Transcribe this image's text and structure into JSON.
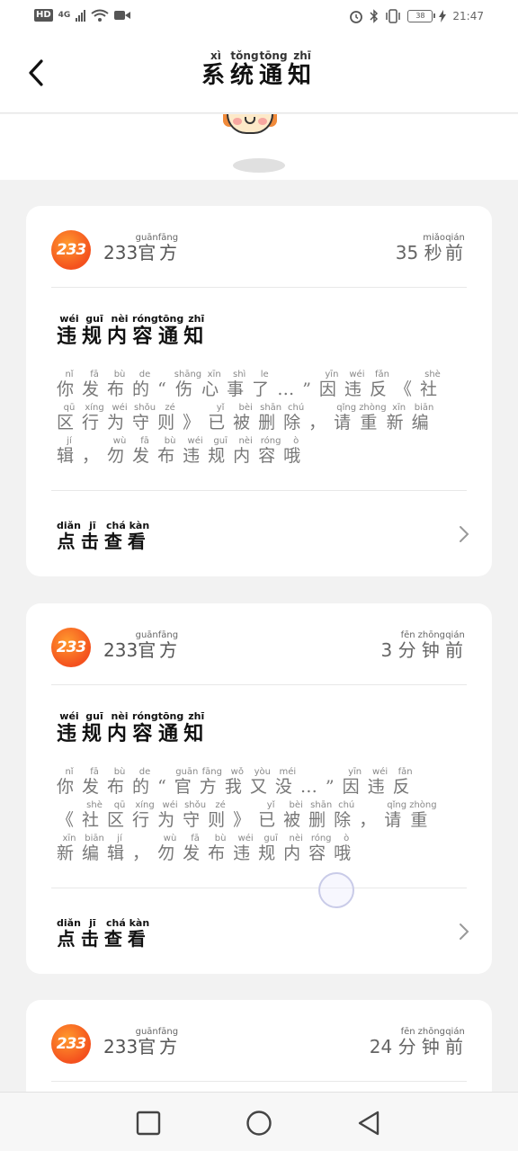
{
  "status_bar": {
    "network_badge": "HD",
    "signal_label": "4G",
    "battery": "38",
    "time": "21:47",
    "icons": [
      "hd-icon",
      "signal-icon",
      "wifi-icon",
      "video-icon",
      "alarm-icon",
      "bluetooth-icon",
      "vibrate-icon",
      "battery-icon",
      "charging-icon"
    ]
  },
  "header": {
    "title": [
      {
        "ch": "系",
        "py": "xì"
      },
      {
        "ch": "统",
        "py": "tǒng"
      },
      {
        "ch": "通",
        "py": "tōng"
      },
      {
        "ch": "知",
        "py": "zhī"
      }
    ]
  },
  "notifications": [
    {
      "logo": "233",
      "sender_num": "233",
      "sender": [
        {
          "ch": "官",
          "py": "guān"
        },
        {
          "ch": "方",
          "py": "fāng"
        }
      ],
      "time_num": "35",
      "time": [
        {
          "ch": "秒",
          "py": "miǎo"
        },
        {
          "ch": "前",
          "py": "qián"
        }
      ],
      "title": [
        {
          "ch": "违",
          "py": "wéi"
        },
        {
          "ch": "规",
          "py": "guī"
        },
        {
          "ch": "内",
          "py": "nèi"
        },
        {
          "ch": "容",
          "py": "róng"
        },
        {
          "ch": "通",
          "py": "tōng"
        },
        {
          "ch": "知",
          "py": "zhī"
        }
      ],
      "body": [
        {
          "ch": "你",
          "py": "nǐ"
        },
        {
          "ch": "发",
          "py": "fā"
        },
        {
          "ch": "布",
          "py": "bù"
        },
        {
          "ch": "的",
          "py": "de"
        },
        {
          "ch": "“",
          "py": ""
        },
        {
          "ch": "伤",
          "py": "shāng"
        },
        {
          "ch": "心",
          "py": "xīn"
        },
        {
          "ch": "事",
          "py": "shì"
        },
        {
          "ch": "了",
          "py": "le"
        },
        {
          "ch": "…",
          "py": ""
        },
        {
          "ch": "”",
          "py": ""
        },
        {
          "ch": "因",
          "py": "yīn"
        },
        {
          "ch": "违",
          "py": "wéi"
        },
        {
          "ch": "反",
          "py": "fǎn"
        },
        {
          "ch": "《",
          "py": ""
        },
        {
          "ch": "社",
          "py": "shè"
        },
        {
          "ch": "区",
          "py": "qū"
        },
        {
          "ch": "行",
          "py": "xíng"
        },
        {
          "ch": "为",
          "py": "wéi"
        },
        {
          "ch": "守",
          "py": "shǒu"
        },
        {
          "ch": "则",
          "py": "zé"
        },
        {
          "ch": "》",
          "py": ""
        },
        {
          "ch": "已",
          "py": "yǐ"
        },
        {
          "ch": "被",
          "py": "bèi"
        },
        {
          "ch": "删",
          "py": "shān"
        },
        {
          "ch": "除",
          "py": "chú"
        },
        {
          "ch": "，",
          "py": ""
        },
        {
          "ch": "请",
          "py": "qǐng"
        },
        {
          "ch": "重",
          "py": "zhòng"
        },
        {
          "ch": "新",
          "py": "xīn"
        },
        {
          "ch": "编",
          "py": "biān"
        },
        {
          "ch": "辑",
          "py": "jí"
        },
        {
          "ch": "，",
          "py": ""
        },
        {
          "ch": "勿",
          "py": "wù"
        },
        {
          "ch": "发",
          "py": "fā"
        },
        {
          "ch": "布",
          "py": "bù"
        },
        {
          "ch": "违",
          "py": "wéi"
        },
        {
          "ch": "规",
          "py": "guī"
        },
        {
          "ch": "内",
          "py": "nèi"
        },
        {
          "ch": "容",
          "py": "róng"
        },
        {
          "ch": "哦",
          "py": "ò"
        }
      ],
      "action": [
        {
          "ch": "点",
          "py": "diǎn"
        },
        {
          "ch": "击",
          "py": "jī"
        },
        {
          "ch": "查",
          "py": "chá"
        },
        {
          "ch": "看",
          "py": "kàn"
        }
      ]
    },
    {
      "logo": "233",
      "sender_num": "233",
      "sender": [
        {
          "ch": "官",
          "py": "guān"
        },
        {
          "ch": "方",
          "py": "fāng"
        }
      ],
      "time_num": "3",
      "time": [
        {
          "ch": "分",
          "py": "fēn"
        },
        {
          "ch": "钟",
          "py": "zhōng"
        },
        {
          "ch": "前",
          "py": "qián"
        }
      ],
      "title": [
        {
          "ch": "违",
          "py": "wéi"
        },
        {
          "ch": "规",
          "py": "guī"
        },
        {
          "ch": "内",
          "py": "nèi"
        },
        {
          "ch": "容",
          "py": "róng"
        },
        {
          "ch": "通",
          "py": "tōng"
        },
        {
          "ch": "知",
          "py": "zhī"
        }
      ],
      "body": [
        {
          "ch": "你",
          "py": "nǐ"
        },
        {
          "ch": "发",
          "py": "fā"
        },
        {
          "ch": "布",
          "py": "bù"
        },
        {
          "ch": "的",
          "py": "de"
        },
        {
          "ch": "“",
          "py": ""
        },
        {
          "ch": "官",
          "py": "guān"
        },
        {
          "ch": "方",
          "py": "fāng"
        },
        {
          "ch": "我",
          "py": "wǒ"
        },
        {
          "ch": "又",
          "py": "yòu"
        },
        {
          "ch": "没",
          "py": "méi"
        },
        {
          "ch": "…",
          "py": ""
        },
        {
          "ch": "”",
          "py": ""
        },
        {
          "ch": "因",
          "py": "yīn"
        },
        {
          "ch": "违",
          "py": "wéi"
        },
        {
          "ch": "反",
          "py": "fǎn"
        },
        {
          "ch": "《",
          "py": ""
        },
        {
          "ch": "社",
          "py": "shè"
        },
        {
          "ch": "区",
          "py": "qū"
        },
        {
          "ch": "行",
          "py": "xíng"
        },
        {
          "ch": "为",
          "py": "wéi"
        },
        {
          "ch": "守",
          "py": "shǒu"
        },
        {
          "ch": "则",
          "py": "zé"
        },
        {
          "ch": "》",
          "py": ""
        },
        {
          "ch": "已",
          "py": "yǐ"
        },
        {
          "ch": "被",
          "py": "bèi"
        },
        {
          "ch": "删",
          "py": "shān"
        },
        {
          "ch": "除",
          "py": "chú"
        },
        {
          "ch": "，",
          "py": ""
        },
        {
          "ch": "请",
          "py": "qǐng"
        },
        {
          "ch": "重",
          "py": "zhòng"
        },
        {
          "ch": "新",
          "py": "xīn"
        },
        {
          "ch": "编",
          "py": "biān"
        },
        {
          "ch": "辑",
          "py": "jí"
        },
        {
          "ch": "，",
          "py": ""
        },
        {
          "ch": "勿",
          "py": "wù"
        },
        {
          "ch": "发",
          "py": "fā"
        },
        {
          "ch": "布",
          "py": "bù"
        },
        {
          "ch": "违",
          "py": "wéi"
        },
        {
          "ch": "规",
          "py": "guī"
        },
        {
          "ch": "内",
          "py": "nèi"
        },
        {
          "ch": "容",
          "py": "róng"
        },
        {
          "ch": "哦",
          "py": "ò"
        }
      ],
      "action": [
        {
          "ch": "点",
          "py": "diǎn"
        },
        {
          "ch": "击",
          "py": "jī"
        },
        {
          "ch": "查",
          "py": "chá"
        },
        {
          "ch": "看",
          "py": "kàn"
        }
      ]
    },
    {
      "logo": "233",
      "sender_num": "233",
      "sender": [
        {
          "ch": "官",
          "py": "guān"
        },
        {
          "ch": "方",
          "py": "fāng"
        }
      ],
      "time_num": "24",
      "time": [
        {
          "ch": "分",
          "py": "fēn"
        },
        {
          "ch": "钟",
          "py": "zhōng"
        },
        {
          "ch": "前",
          "py": "qián"
        }
      ]
    }
  ],
  "colors": {
    "logo_orange": "#f4511e",
    "text_dark": "#111111",
    "text_gray": "#777777",
    "page_bg": "#f2f2f2"
  },
  "nav_bar": {
    "icons": [
      "recent-apps-icon",
      "home-icon",
      "back-nav-icon"
    ]
  }
}
